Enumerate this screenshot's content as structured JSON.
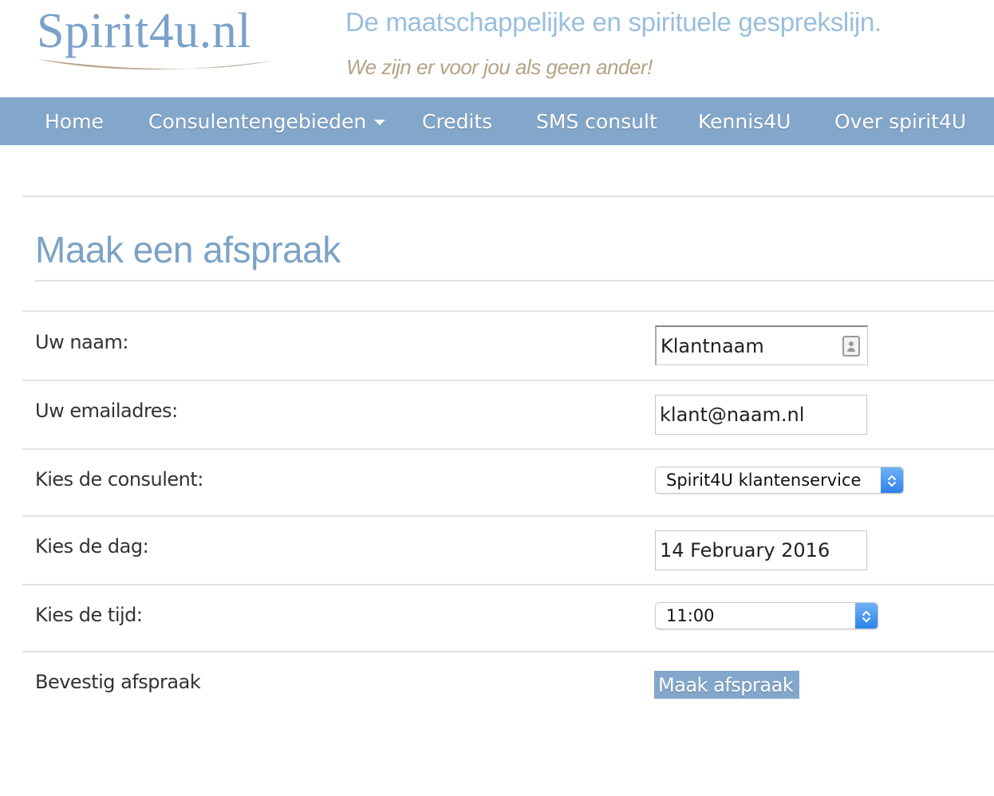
{
  "brand": {
    "logo_text": "Spirit4u.nl",
    "tagline": "De maatschappelijke en spirituele gesprekslijn.",
    "subtagline": "We zijn er voor jou als geen ander!"
  },
  "nav": {
    "items": [
      {
        "label": "Home"
      },
      {
        "label": "Consulentengebieden"
      },
      {
        "label": "Credits"
      },
      {
        "label": "SMS consult"
      },
      {
        "label": "Kennis4U"
      },
      {
        "label": "Over spirit4U"
      }
    ]
  },
  "page": {
    "title": "Maak een afspraak"
  },
  "form": {
    "name": {
      "label": "Uw naam:",
      "value": "Klantnaam"
    },
    "email": {
      "label": "Uw emailadres:",
      "value": "klant@naam.nl"
    },
    "consultant": {
      "label": "Kies de consulent:",
      "value": "Spirit4U klantenservice"
    },
    "day": {
      "label": "Kies de dag:",
      "value": "14 February 2016"
    },
    "time": {
      "label": "Kies de tijd:",
      "value": "11:00"
    },
    "confirm": {
      "label": "Bevestig afspraak",
      "button": "Maak afspraak"
    }
  },
  "colors": {
    "nav_bg": "#83a7cb",
    "title": "#7ba3c6",
    "tagline": "#99bfdc",
    "subtagline": "#b3a387",
    "select_arrow": "#2b7fe8"
  }
}
